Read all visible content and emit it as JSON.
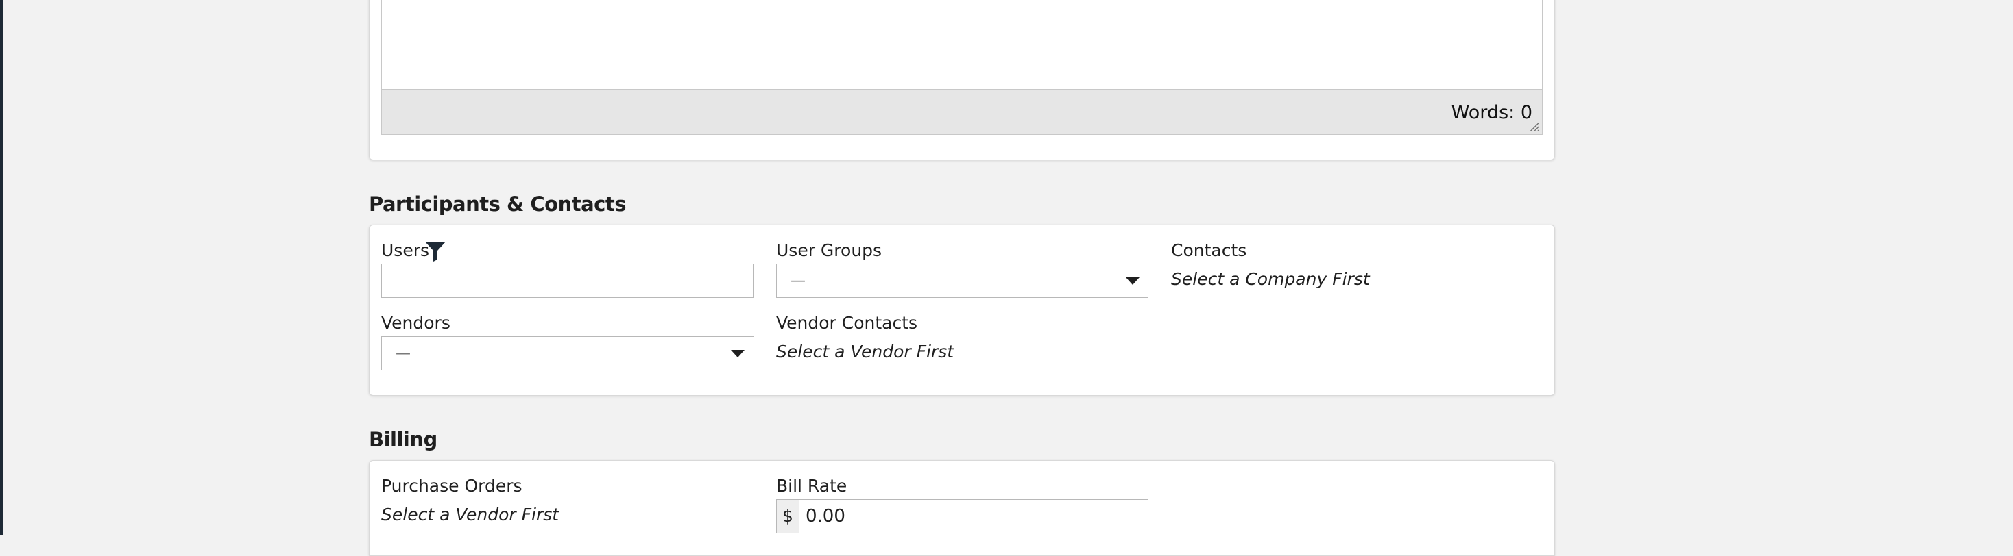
{
  "editor": {
    "word_count": "Words: 0"
  },
  "participants": {
    "title": "Participants & Contacts",
    "users": {
      "label": "Users",
      "value": ""
    },
    "user_groups": {
      "label": "User Groups",
      "selected": "—"
    },
    "contacts": {
      "label": "Contacts",
      "note": "Select a Company First"
    },
    "vendors": {
      "label": "Vendors",
      "selected": "—"
    },
    "vendor_contacts": {
      "label": "Vendor Contacts",
      "note": "Select a Vendor First"
    }
  },
  "billing": {
    "title": "Billing",
    "purchase_orders": {
      "label": "Purchase Orders",
      "note": "Select a Vendor First"
    },
    "bill_rate": {
      "label": "Bill Rate",
      "currency": "$",
      "value": "0.00"
    }
  },
  "colors": {
    "page_background": "#f2f2f2",
    "card_background": "#ffffff",
    "editor_status_bar": "#e6e6e6",
    "filter_icon": "#1e2a36"
  }
}
